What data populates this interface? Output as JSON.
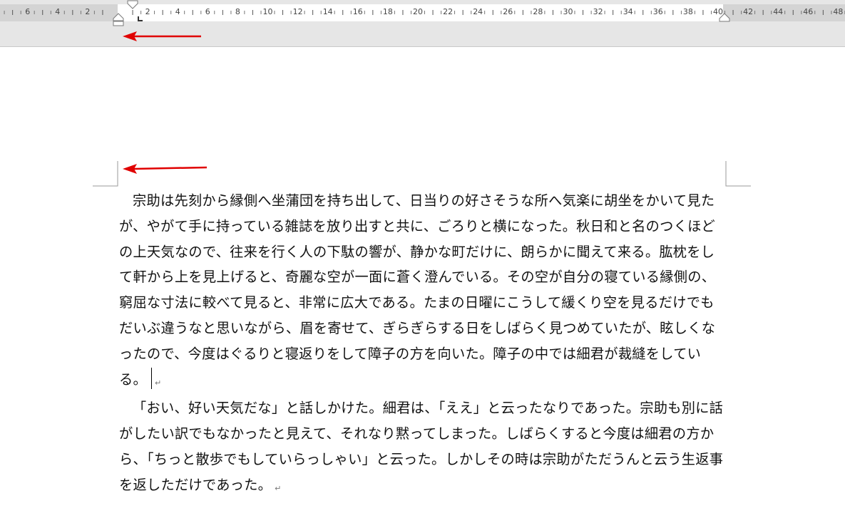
{
  "ruler": {
    "numbers": [
      "8",
      "6",
      "4",
      "2",
      "2",
      "4",
      "6",
      "8",
      "10",
      "12",
      "14",
      "16",
      "18",
      "20",
      "22",
      "24",
      "26",
      "28",
      "30",
      "32",
      "34",
      "36",
      "38",
      "40",
      "42",
      "44",
      "46",
      "48"
    ]
  },
  "colors": {
    "annotation_arrow": "#e00000",
    "ruler_margin": "#d4d4d4",
    "ruler_text_area": "#ffffff"
  },
  "document": {
    "paragraphs": [
      "宗助は先刻から縁側へ坐蒲団を持ち出して、日当りの好さそうな所へ気楽に胡坐をかいて見たが、やがて手に持っている雑誌を放り出すと共に、ごろりと横になった。秋日和と名のつくほどの上天気なので、往来を行く人の下駄の響が、静かな町だけに、朗らかに聞えて来る。肱枕をして軒から上を見上げると、奇麗な空が一面に蒼く澄んでいる。その空が自分の寝ている縁側の、窮屈な寸法に較べて見ると、非常に広大である。たまの日曜にこうして緩くり空を見るだけでもだいぶ違うなと思いながら、眉を寄せて、ぎらぎらする日をしばらく見つめていたが、眩しくなったので、今度はぐるりと寝返りをして障子の方を向いた。障子の中では細君が裁縫をしている。",
      "「おい、好い天気だな」と話しかけた。細君は、「ええ」と云ったなりであった。宗助も別に話がしたい訳でもなかったと見えて、それなり黙ってしまった。しばらくすると今度は細君の方から、「ちっと散歩でもしていらっしゃい」と云った。しかしその時は宗助がただうんと云う生返事を返しただけであった。"
    ],
    "paragraph_mark": "↵"
  }
}
